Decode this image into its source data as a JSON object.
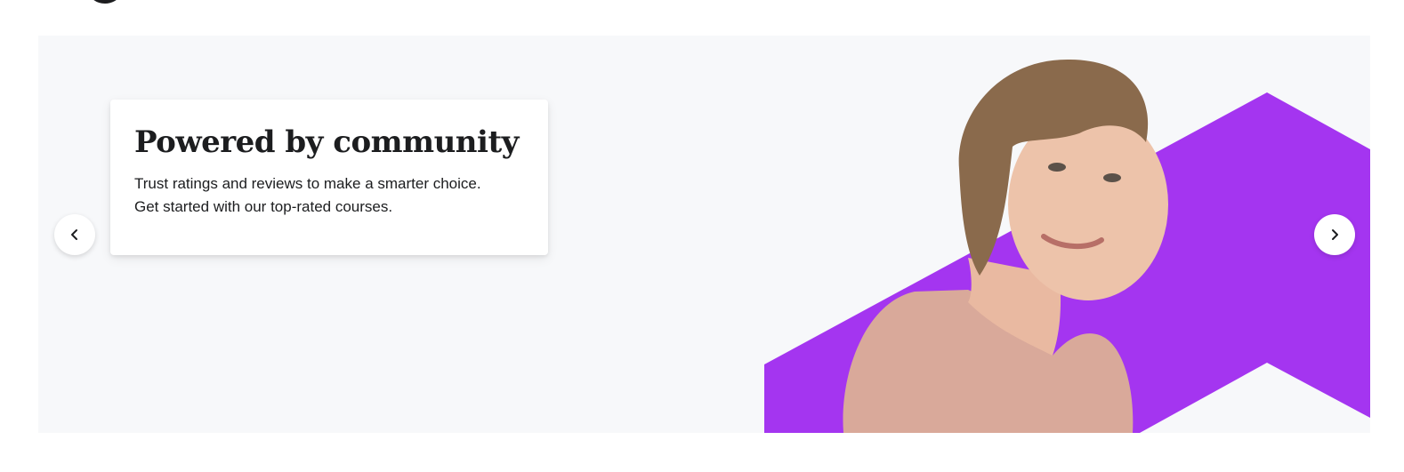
{
  "hero": {
    "title": "Powered by community",
    "description_line1": "Trust ratings and reviews to make a smarter choice.",
    "description_line2": "Get started with our top-rated courses.",
    "prev_icon": "chevron-left-icon",
    "next_icon": "chevron-right-icon",
    "accent_color": "#a435f0",
    "background_color": "#f7f8fa"
  }
}
